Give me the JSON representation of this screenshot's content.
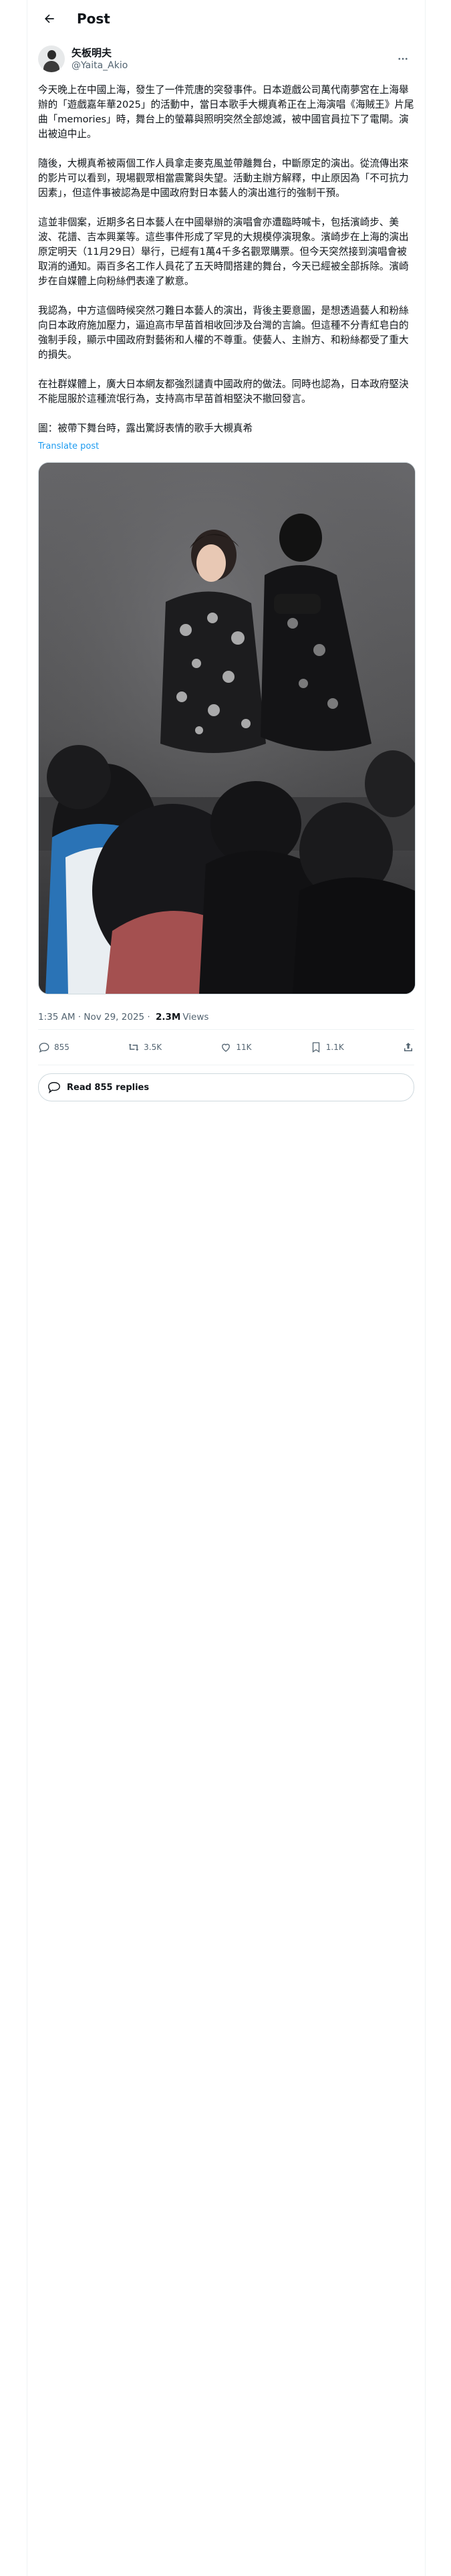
{
  "header": {
    "title": "Post"
  },
  "author": {
    "display_name": "矢板明夫",
    "handle": "@Yaita_Akio"
  },
  "post": {
    "paragraphs": [
      "今天晚上在中國上海，發生了一件荒唐的突發事件。日本遊戲公司萬代南夢宮在上海舉辦的「遊戲嘉年華2025」的活動中，當日本歌手大槻真希正在上海演唱《海賊王》片尾曲「memories」時，舞台上的螢幕與照明突然全部熄滅，被中國官員拉下了電閘。演出被迫中止。",
      "隨後，大槻真希被兩個工作人員拿走麥克風並帶離舞台，中斷原定的演出。從流傳出來的影片可以看到，現場觀眾相當震驚與失望。活動主辦方解釋，中止原因為「不可抗力因素」，但這件事被認為是中國政府對日本藝人的演出進行的強制干預。",
      "這並非個案，近期多名日本藝人在中國舉辦的演唱會亦遭臨時喊卡，包括濱崎步、美波、花譜、吉本興業等。這些事件形成了罕見的大規模停演現象。濱崎步在上海的演出原定明天（11月29日）舉行，已經有1萬4千多名觀眾購票。但今天突然接到演唱會被取消的通知。兩百多名工作人員花了五天時間搭建的舞台，今天已經被全部拆除。濱崎步在自媒體上向粉絲們表達了歉意。",
      "我認為，中方這個時候突然刁難日本藝人的演出，背後主要意圖，是想透過藝人和粉絲向日本政府施加壓力，逼迫高市早苗首相收回涉及台灣的言論。但這種不分青紅皂白的強制手段，顯示中國政府對藝術和人權的不尊重。使藝人、主辦方、和粉絲都受了重大的損失。",
      "在社群媒體上，廣大日本網友都強烈譴責中國政府的做法。同時也認為，日本政府堅決不能屈服於這種流氓行為，支持高市早苗首相堅決不撤回發言。",
      "圖：被帶下舞台時，露出驚訝表情的歌手大槻真希"
    ],
    "translate_label": "Translate post"
  },
  "meta": {
    "time": "1:35 AM · Nov 29, 2025",
    "views_count": "2.3M",
    "views_label": "Views"
  },
  "actions": {
    "replies": "855",
    "reposts": "3.5K",
    "likes": "11K",
    "bookmarks": "1.1K"
  },
  "read_replies": "Read 855 replies",
  "icons": [
    "back-arrow-icon",
    "more-icon",
    "reply-icon",
    "repost-icon",
    "like-icon",
    "bookmark-icon",
    "share-icon",
    "speech-bubble-icon"
  ]
}
